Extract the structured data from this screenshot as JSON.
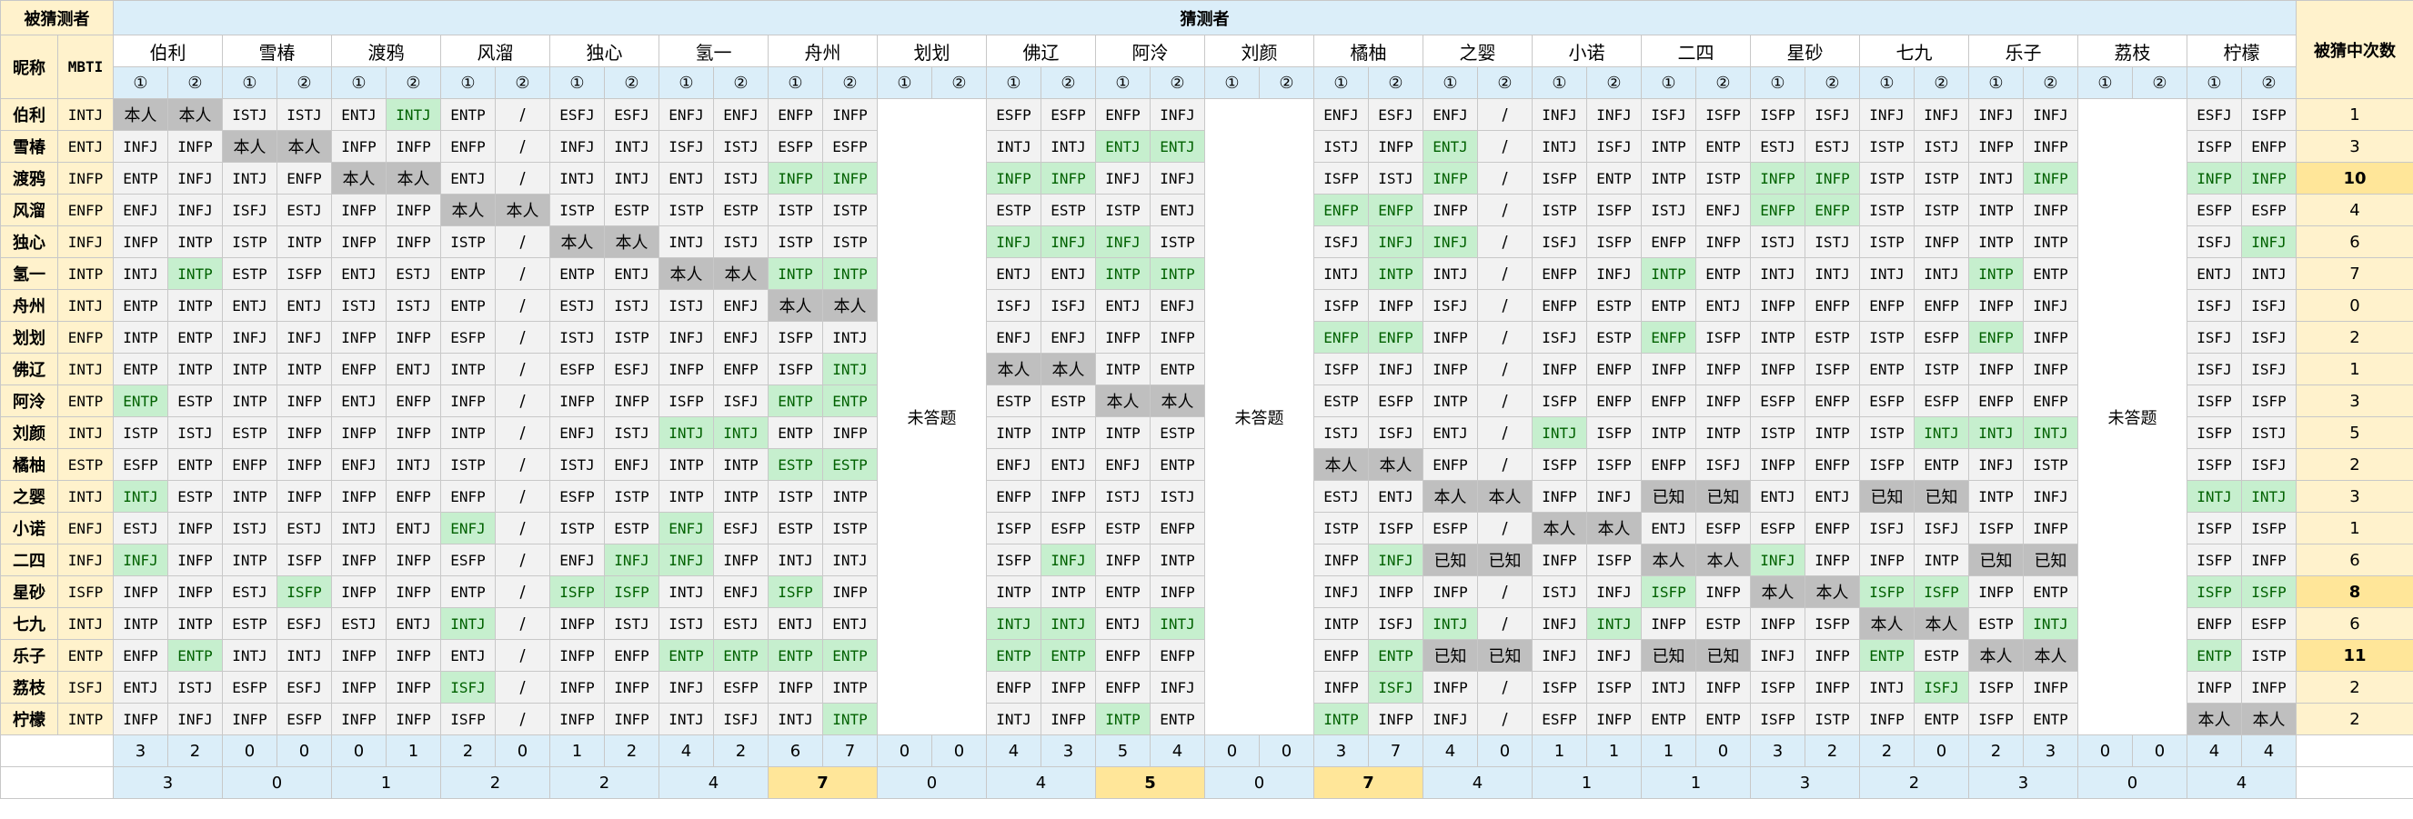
{
  "header": {
    "guessed_label": "被猜测者",
    "guessers_label": "猜测者",
    "nickname_label": "昵称",
    "mbti_label": "MBTI",
    "count_label": "被猜中次数",
    "not_answered": "未答题"
  },
  "guessers": [
    "伯利",
    "雪椿",
    "渡鸦",
    "风溜",
    "独心",
    "氢一",
    "舟州",
    "划划",
    "佛辽",
    "阿泠",
    "刘颜",
    "橘柚",
    "之婴",
    "小诺",
    "二四",
    "星砂",
    "七九",
    "乐子",
    "荔枝",
    "柠檬"
  ],
  "subcols": [
    "①",
    "②"
  ],
  "rows": [
    {
      "name": "伯利",
      "mbti": "INTJ",
      "cells": [
        "本人",
        "本人",
        "ISTJ",
        "ISTJ",
        "ENTJ",
        "INTJ",
        "ENTP",
        "/",
        "ESFJ",
        "ESFJ",
        "ENFJ",
        "ENFJ",
        "ENFP",
        "INFP",
        "",
        "",
        "ESFP",
        "ESFP",
        "ENFP",
        "INFJ",
        "",
        "",
        "ENFJ",
        "ESFJ",
        "ENFJ",
        "/",
        "INFJ",
        "INFJ",
        "ISFJ",
        "ISFP",
        "ISFP",
        "ISFJ",
        "INFJ",
        "INFJ",
        "INFJ",
        "INFJ",
        "",
        "",
        "ESFJ",
        "ISFP"
      ],
      "count": "1"
    },
    {
      "name": "雪椿",
      "mbti": "ENTJ",
      "cells": [
        "INFJ",
        "INFP",
        "本人",
        "本人",
        "INFP",
        "INFP",
        "ENFP",
        "/",
        "INFJ",
        "INTJ",
        "ISFJ",
        "ISTJ",
        "ESFP",
        "ESFP",
        "",
        "",
        "INTJ",
        "INTJ",
        "ENTJ",
        "ENTJ",
        "",
        "",
        "ISTJ",
        "INFP",
        "ENTJ",
        "/",
        "INTJ",
        "ISFJ",
        "INTP",
        "ENTP",
        "ESTJ",
        "ESTJ",
        "ISTP",
        "ISTJ",
        "INFP",
        "INFP",
        "",
        "",
        "ISFP",
        "ENFP"
      ],
      "count": "3"
    },
    {
      "name": "渡鸦",
      "mbti": "INFP",
      "cells": [
        "ENTP",
        "INFJ",
        "INTJ",
        "ENFP",
        "本人",
        "本人",
        "ENTJ",
        "/",
        "INTJ",
        "INTJ",
        "ENTJ",
        "ISTJ",
        "INFP",
        "INFP",
        "",
        "",
        "INFP",
        "INFP",
        "INFJ",
        "INFJ",
        "",
        "",
        "ISFP",
        "ISTJ",
        "INFP",
        "/",
        "ISFP",
        "ENTP",
        "INTP",
        "ISTP",
        "INFP",
        "INFP",
        "ISTP",
        "ISTP",
        "INTJ",
        "INFP",
        "",
        "",
        "INFP",
        "INFP"
      ],
      "count": "10"
    },
    {
      "name": "风溜",
      "mbti": "ENFP",
      "cells": [
        "ENFJ",
        "INFJ",
        "ISFJ",
        "ESTJ",
        "INFP",
        "INFP",
        "本人",
        "本人",
        "ISTP",
        "ESTP",
        "ISTP",
        "ESTP",
        "ISTP",
        "ISTP",
        "",
        "",
        "ESTP",
        "ESTP",
        "ISTP",
        "ENTJ",
        "",
        "",
        "ENFP",
        "ENFP",
        "INFP",
        "/",
        "ISTP",
        "ISFP",
        "ISTJ",
        "ENFJ",
        "ENFP",
        "ENFP",
        "ISTP",
        "ISTP",
        "INTP",
        "INFP",
        "",
        "",
        "ESFP",
        "ESFP"
      ],
      "count": "4"
    },
    {
      "name": "独心",
      "mbti": "INFJ",
      "cells": [
        "INFP",
        "INTP",
        "ISTP",
        "INTP",
        "INFP",
        "INFP",
        "ISTP",
        "/",
        "本人",
        "本人",
        "INTJ",
        "ISTJ",
        "ISTP",
        "ISTP",
        "",
        "",
        "INFJ",
        "INFJ",
        "INFJ",
        "ISTP",
        "",
        "",
        "ISFJ",
        "INFJ",
        "INFJ",
        "/",
        "ISFJ",
        "ISFP",
        "ENFP",
        "INFP",
        "ISTJ",
        "ISTJ",
        "ISTP",
        "INFP",
        "INTP",
        "INTP",
        "",
        "",
        "ISFJ",
        "INFJ"
      ],
      "count": "6"
    },
    {
      "name": "氢一",
      "mbti": "INTP",
      "cells": [
        "INTJ",
        "INTP",
        "ESTP",
        "ISFP",
        "ENTJ",
        "ESTJ",
        "ENTP",
        "/",
        "ENTP",
        "ENTJ",
        "本人",
        "本人",
        "INTP",
        "INTP",
        "",
        "",
        "ENTJ",
        "ENTJ",
        "INTP",
        "INTP",
        "",
        "",
        "INTJ",
        "INTP",
        "INTJ",
        "/",
        "ENFP",
        "INFJ",
        "INTP",
        "ENTP",
        "INTJ",
        "INTJ",
        "INTJ",
        "INTJ",
        "INTP",
        "ENTP",
        "",
        "",
        "ENTJ",
        "INTJ"
      ],
      "count": "7"
    },
    {
      "name": "舟州",
      "mbti": "INTJ",
      "cells": [
        "ENTP",
        "INTP",
        "ENTJ",
        "ENTJ",
        "ISTJ",
        "ISTJ",
        "ENTP",
        "/",
        "ESTJ",
        "ISTJ",
        "ISTJ",
        "ENFJ",
        "本人",
        "本人",
        "",
        "",
        "ISFJ",
        "ISFJ",
        "ENTJ",
        "ENFJ",
        "",
        "",
        "ISFP",
        "INFP",
        "ISFJ",
        "/",
        "ENFP",
        "ESTP",
        "ENTP",
        "ENTJ",
        "INFP",
        "ENFP",
        "ENFP",
        "ENFP",
        "INFP",
        "INFJ",
        "",
        "",
        "ISFJ",
        "ISFJ"
      ],
      "count": "0"
    },
    {
      "name": "划划",
      "mbti": "ENFP",
      "cells": [
        "INTP",
        "ENTP",
        "INFJ",
        "INFJ",
        "INFP",
        "INFP",
        "ESFP",
        "/",
        "ISTJ",
        "ISTP",
        "INFJ",
        "ENFJ",
        "ISFP",
        "INTJ",
        "",
        "",
        "ENFJ",
        "ENFJ",
        "INFP",
        "INFP",
        "",
        "",
        "ENFP",
        "ENFP",
        "INFP",
        "/",
        "ISFJ",
        "ESTP",
        "ENFP",
        "ISFP",
        "INTP",
        "ESTP",
        "ISTP",
        "ESFP",
        "ENFP",
        "INFP",
        "",
        "",
        "ISFJ",
        "ISFJ"
      ],
      "count": "2"
    },
    {
      "name": "佛辽",
      "mbti": "INTJ",
      "cells": [
        "ENTP",
        "INTP",
        "INTP",
        "INTP",
        "ENFP",
        "ENTJ",
        "INTP",
        "/",
        "ESFP",
        "ESFJ",
        "INFP",
        "ENFP",
        "ISFP",
        "INTJ",
        "",
        "",
        "本人",
        "本人",
        "INTP",
        "ENTP",
        "",
        "",
        "ISFP",
        "INFJ",
        "INFP",
        "/",
        "INFP",
        "ENFP",
        "INFP",
        "INFP",
        "INFP",
        "ISFP",
        "ENTP",
        "ISTP",
        "INFP",
        "INFP",
        "",
        "",
        "ISFJ",
        "ISFJ"
      ],
      "count": "1"
    },
    {
      "name": "阿泠",
      "mbti": "ENTP",
      "cells": [
        "ENTP",
        "ESTP",
        "INTP",
        "INFP",
        "ENTJ",
        "ENFP",
        "INFP",
        "/",
        "INFP",
        "INFP",
        "ISFP",
        "ISFJ",
        "ENTP",
        "ENTP",
        "",
        "",
        "ESTP",
        "ESTP",
        "本人",
        "本人",
        "",
        "",
        "ESTP",
        "ESFP",
        "INTP",
        "/",
        "ISFP",
        "ENFP",
        "ENFP",
        "INFP",
        "ESFP",
        "ENFP",
        "ESFP",
        "ESFP",
        "ENFP",
        "ENFP",
        "",
        "",
        "ISFP",
        "ISFP"
      ],
      "count": "3"
    },
    {
      "name": "刘颜",
      "mbti": "INTJ",
      "cells": [
        "ISTP",
        "ISTJ",
        "ESTP",
        "INFP",
        "INFP",
        "INFP",
        "INTP",
        "/",
        "ENFJ",
        "ISTJ",
        "INTJ",
        "INTJ",
        "ENTP",
        "INFP",
        "",
        "",
        "INTP",
        "INTP",
        "INTP",
        "ESTP",
        "",
        "",
        "ISTJ",
        "ISFJ",
        "ENTJ",
        "/",
        "INTJ",
        "ISFP",
        "INTP",
        "INTP",
        "ISTP",
        "INTP",
        "ISTP",
        "INTJ",
        "INTJ",
        "INTJ",
        "",
        "",
        "ISFP",
        "ISTJ"
      ],
      "count": "5"
    },
    {
      "name": "橘柚",
      "mbti": "ESTP",
      "cells": [
        "ESFP",
        "ENTP",
        "ENFP",
        "INFP",
        "ENFJ",
        "INTJ",
        "ISTP",
        "/",
        "ISTJ",
        "ENFJ",
        "INTP",
        "INTP",
        "ESTP",
        "ESTP",
        "",
        "",
        "ENFJ",
        "ENTJ",
        "ENFJ",
        "ENTP",
        "",
        "",
        "本人",
        "本人",
        "ENFP",
        "/",
        "ISFP",
        "ISFP",
        "ENFP",
        "ISFJ",
        "INFP",
        "ENFP",
        "ISFP",
        "ENTP",
        "INFJ",
        "ISTP",
        "",
        "",
        "ISFP",
        "ISFJ"
      ],
      "count": "2"
    },
    {
      "name": "之婴",
      "mbti": "INTJ",
      "cells": [
        "INTJ",
        "ESTP",
        "INTP",
        "INFP",
        "INFP",
        "ENFP",
        "ENFP",
        "/",
        "ESFP",
        "ISTP",
        "INTP",
        "INTP",
        "ISTP",
        "INTP",
        "",
        "",
        "ENFP",
        "INFP",
        "ISTJ",
        "ISTJ",
        "",
        "",
        "ESTJ",
        "ENTJ",
        "本人",
        "本人",
        "INFP",
        "INFJ",
        "已知",
        "已知",
        "ENTJ",
        "ENTJ",
        "已知",
        "已知",
        "INTP",
        "INFJ",
        "",
        "",
        "INTJ",
        "INTJ"
      ],
      "count": "3"
    },
    {
      "name": "小诺",
      "mbti": "ENFJ",
      "cells": [
        "ESTJ",
        "INFP",
        "ISTJ",
        "ESTJ",
        "INTJ",
        "ENTJ",
        "ENFJ",
        "/",
        "ISTP",
        "ESTP",
        "ENFJ",
        "ESFJ",
        "ESTP",
        "ISTP",
        "",
        "",
        "ISFP",
        "ESFP",
        "ESTP",
        "ENFP",
        "",
        "",
        "ISTP",
        "ISFP",
        "ESFP",
        "/",
        "本人",
        "本人",
        "ENTJ",
        "ESFP",
        "ESFP",
        "ENFP",
        "ISFJ",
        "ISFJ",
        "ISFP",
        "INFP",
        "",
        "",
        "ISFP",
        "ISFP"
      ],
      "count": "1"
    },
    {
      "name": "二四",
      "mbti": "INFJ",
      "cells": [
        "INFJ",
        "INFP",
        "INTP",
        "ISFP",
        "INFP",
        "INFP",
        "ESFP",
        "/",
        "ENFJ",
        "INFJ",
        "INFJ",
        "INFP",
        "INTJ",
        "INTJ",
        "",
        "",
        "ISFP",
        "INFJ",
        "INFP",
        "INTP",
        "",
        "",
        "INFP",
        "INFJ",
        "已知",
        "已知",
        "INFP",
        "ISFP",
        "本人",
        "本人",
        "INFJ",
        "INFP",
        "INFP",
        "INTP",
        "已知",
        "已知",
        "",
        "",
        "ISFP",
        "INFP"
      ],
      "count": "6"
    },
    {
      "name": "星砂",
      "mbti": "ISFP",
      "cells": [
        "INFP",
        "INFP",
        "ESTJ",
        "ISFP",
        "INFP",
        "INFP",
        "ENTP",
        "/",
        "ISFP",
        "ISFP",
        "INTJ",
        "ENFJ",
        "ISFP",
        "INFP",
        "",
        "",
        "INTP",
        "INTP",
        "ENTP",
        "INFP",
        "",
        "",
        "INFJ",
        "INFP",
        "INFP",
        "/",
        "ISTJ",
        "INFJ",
        "ISFP",
        "INFP",
        "本人",
        "本人",
        "ISFP",
        "ISFP",
        "INFP",
        "ENTP",
        "",
        "",
        "ISFP",
        "ISFP"
      ],
      "count": "8"
    },
    {
      "name": "七九",
      "mbti": "INTJ",
      "cells": [
        "INTP",
        "INTP",
        "ESTP",
        "ESFJ",
        "ESTJ",
        "ENTJ",
        "INTJ",
        "/",
        "INFP",
        "ISTJ",
        "ISTJ",
        "ESTJ",
        "ENTJ",
        "ENTJ",
        "",
        "",
        "INTJ",
        "INTJ",
        "ENTJ",
        "INTJ",
        "",
        "",
        "INTP",
        "ISFJ",
        "INTJ",
        "/",
        "INFJ",
        "INTJ",
        "INFP",
        "ESTP",
        "INFP",
        "ISFP",
        "本人",
        "本人",
        "ESTP",
        "INTJ",
        "",
        "",
        "ENFP",
        "ESFP"
      ],
      "count": "6"
    },
    {
      "name": "乐子",
      "mbti": "ENTP",
      "cells": [
        "ENFP",
        "ENTP",
        "INTJ",
        "INTJ",
        "INFP",
        "INFP",
        "ENTJ",
        "/",
        "INFP",
        "ENFP",
        "ENTP",
        "ENTP",
        "ENTP",
        "ENTP",
        "",
        "",
        "ENTP",
        "ENTP",
        "ENFP",
        "ENFP",
        "",
        "",
        "ENFP",
        "ENTP",
        "已知",
        "已知",
        "INFJ",
        "INFJ",
        "已知",
        "已知",
        "INFJ",
        "INFP",
        "ENTP",
        "ESTP",
        "本人",
        "本人",
        "",
        "",
        "ENTP",
        "ISTP"
      ],
      "count": "11"
    },
    {
      "name": "荔枝",
      "mbti": "ISFJ",
      "cells": [
        "ENTJ",
        "ISTJ",
        "ESFP",
        "ESFJ",
        "INFP",
        "INFP",
        "ISFJ",
        "/",
        "INFP",
        "INFP",
        "INFJ",
        "ESFP",
        "INFP",
        "INTP",
        "",
        "",
        "ENFP",
        "INFP",
        "ENFP",
        "INFJ",
        "",
        "",
        "INFP",
        "ISFJ",
        "INFP",
        "/",
        "ISFP",
        "ISFP",
        "INTJ",
        "INFP",
        "ISFP",
        "INFP",
        "INTJ",
        "ISFJ",
        "ISFP",
        "INFP",
        "",
        "",
        "INFP",
        "INFP"
      ],
      "count": "2"
    },
    {
      "name": "柠檬",
      "mbti": "INTP",
      "cells": [
        "INFP",
        "INFJ",
        "INFP",
        "ESFP",
        "INFP",
        "INFP",
        "ISFP",
        "/",
        "INFP",
        "INFP",
        "INTJ",
        "ISFJ",
        "INTJ",
        "INTP",
        "",
        "",
        "INTJ",
        "INFP",
        "INTP",
        "ENTP",
        "",
        "",
        "INTP",
        "INFP",
        "INFJ",
        "/",
        "ESFP",
        "INFP",
        "ENTP",
        "ENTP",
        "ISFP",
        "ISTP",
        "INFP",
        "ENTP",
        "ISFP",
        "ENTP",
        "",
        "",
        "本人",
        "本人"
      ],
      "count": "2"
    }
  ],
  "totals1": [
    "3",
    "2",
    "0",
    "0",
    "0",
    "1",
    "2",
    "0",
    "1",
    "2",
    "4",
    "2",
    "6",
    "7",
    "0",
    "0",
    "4",
    "3",
    "5",
    "4",
    "0",
    "0",
    "3",
    "7",
    "4",
    "0",
    "1",
    "1",
    "1",
    "0",
    "3",
    "2",
    "2",
    "0",
    "2",
    "3",
    "0",
    "0",
    "4",
    "4"
  ],
  "totals2": [
    "3",
    "0",
    "1",
    "2",
    "2",
    "4",
    "7",
    "0",
    "4",
    "5",
    "0",
    "7",
    "4",
    "1",
    "1",
    "3",
    "2",
    "3",
    "0",
    "4"
  ],
  "colors": {
    "green": "#c6efce",
    "green_text": "#006100",
    "self": "#bfbfbf",
    "yellow": "#fff2cc",
    "highlight": "#ffe699",
    "blue": "#ddebf7"
  }
}
